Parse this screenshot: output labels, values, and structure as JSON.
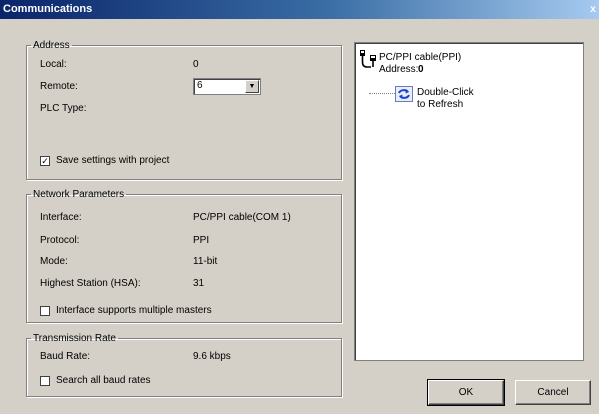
{
  "window": {
    "title": "Communications",
    "close_glyph": "x"
  },
  "address": {
    "legend": "Address",
    "local_label": "Local:",
    "local_value": "0",
    "remote_label": "Remote:",
    "remote_value": "6",
    "plc_type_label": "PLC Type:",
    "save_settings_label": "Save settings with project",
    "save_settings_checked": true
  },
  "network": {
    "legend": "Network Parameters",
    "interface_label": "Interface:",
    "interface_value": "PC/PPI cable(COM 1)",
    "protocol_label": "Protocol:",
    "protocol_value": "PPI",
    "mode_label": "Mode:",
    "mode_value": "11-bit",
    "hsa_label": "Highest Station (HSA):",
    "hsa_value": "31",
    "multi_master_label": "Interface supports multiple masters",
    "multi_master_checked": false
  },
  "transmission": {
    "legend": "Transmission Rate",
    "baud_label": "Baud Rate:",
    "baud_value": "9.6 kbps",
    "search_all_label": "Search all baud rates",
    "search_all_checked": false
  },
  "tree": {
    "cable_label": "PC/PPI cable(PPI)",
    "address_label": "Address:",
    "address_value": "0",
    "refresh_line1": "Double-Click",
    "refresh_line2": "to Refresh"
  },
  "buttons": {
    "ok": "OK",
    "cancel": "Cancel"
  },
  "icons": {
    "cable": "cable-icon",
    "refresh": "refresh-icon",
    "dropdown": "chevron-down-icon"
  }
}
